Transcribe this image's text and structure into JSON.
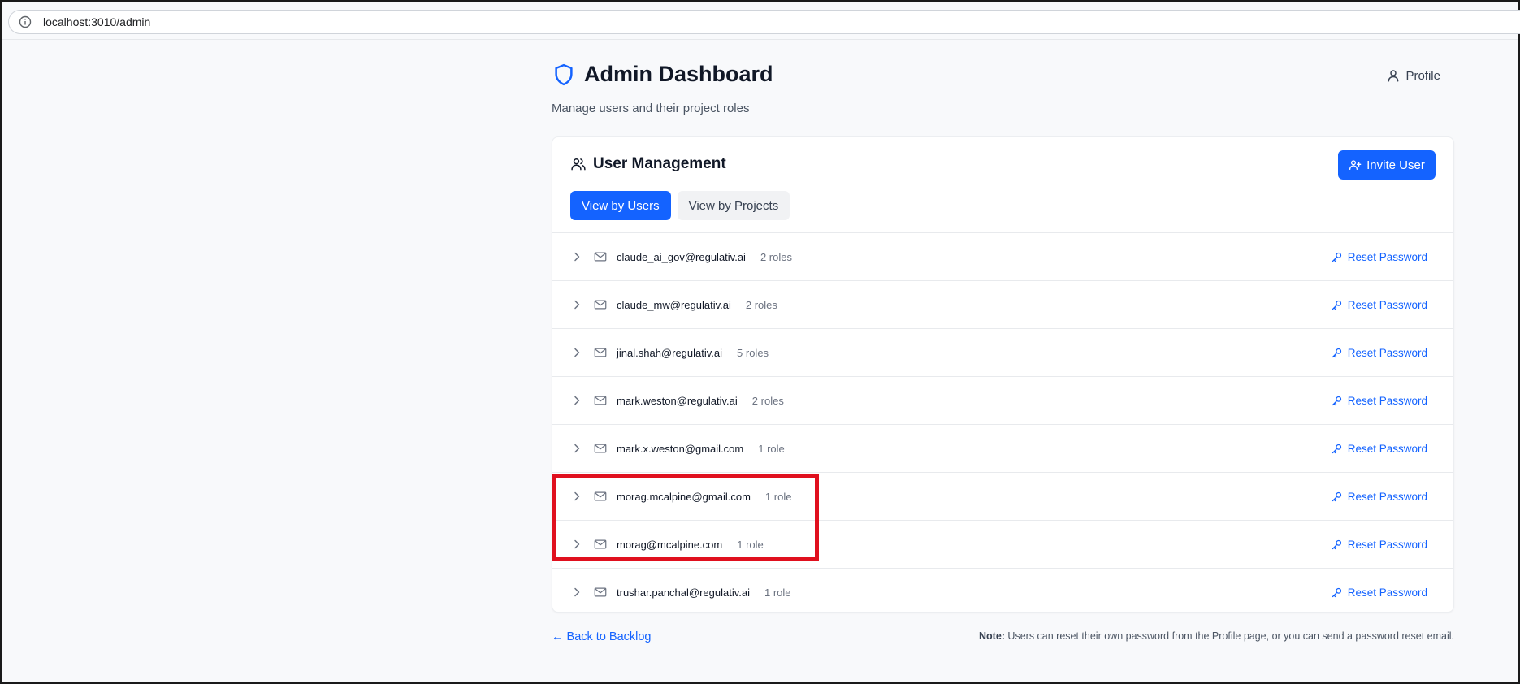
{
  "browser": {
    "url": "localhost:3010/admin"
  },
  "header": {
    "title": "Admin Dashboard",
    "subtitle": "Manage users and their project roles",
    "profile_label": "Profile"
  },
  "card": {
    "title": "User Management",
    "invite_label": "Invite User",
    "tabs": [
      {
        "label": "View by Users",
        "active": true
      },
      {
        "label": "View by Projects",
        "active": false
      }
    ],
    "reset_label": "Reset Password",
    "users": [
      {
        "email": "claude_ai_gov@regulativ.ai",
        "roles": "2 roles"
      },
      {
        "email": "claude_mw@regulativ.ai",
        "roles": "2 roles"
      },
      {
        "email": "jinal.shah@regulativ.ai",
        "roles": "5 roles"
      },
      {
        "email": "mark.weston@regulativ.ai",
        "roles": "2 roles"
      },
      {
        "email": "mark.x.weston@gmail.com",
        "roles": "1 role"
      },
      {
        "email": "morag.mcalpine@gmail.com",
        "roles": "1 role"
      },
      {
        "email": "morag@mcalpine.com",
        "roles": "1 role"
      },
      {
        "email": "trushar.panchal@regulativ.ai",
        "roles": "1 role"
      }
    ]
  },
  "footer": {
    "back_label": "← Back to Backlog",
    "note_bold": "Note:",
    "note_text": " Users can reset their own password from the Profile page, or you can send a password reset email."
  },
  "colors": {
    "accent": "#1463ff",
    "highlight": "#e0101e"
  }
}
